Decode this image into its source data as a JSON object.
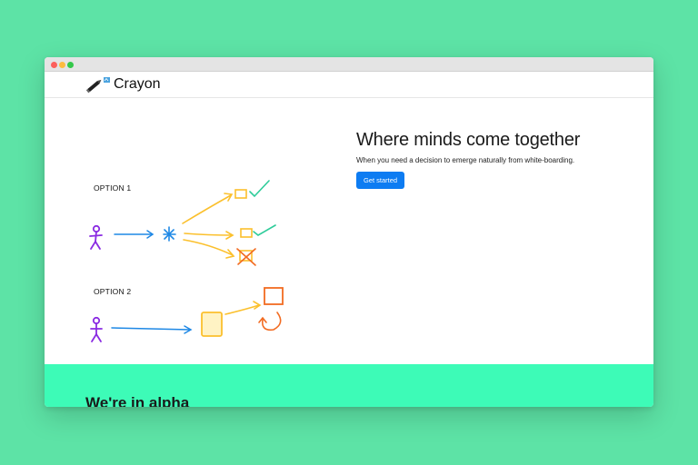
{
  "brand": {
    "name": "Crayon",
    "icon": "crayon-pencil-icon"
  },
  "illustration": {
    "option1_label": "OPTION 1",
    "option2_label": "OPTION 2"
  },
  "hero": {
    "title": "Where minds come together",
    "subtitle": "When you need a decision to emerge naturally from white-boarding.",
    "cta_label": "Get started"
  },
  "alpha_section": {
    "title": "We're in alpha"
  },
  "colors": {
    "background": "#5de3a6",
    "cta": "#0d7cf2",
    "band": "#3dfbb7",
    "person": "#8a2be2",
    "arrow_blue": "#1e88e5",
    "arrow_yellow": "#fbc02d",
    "check_green": "#2ecc9a",
    "orange": "#f26b21"
  }
}
